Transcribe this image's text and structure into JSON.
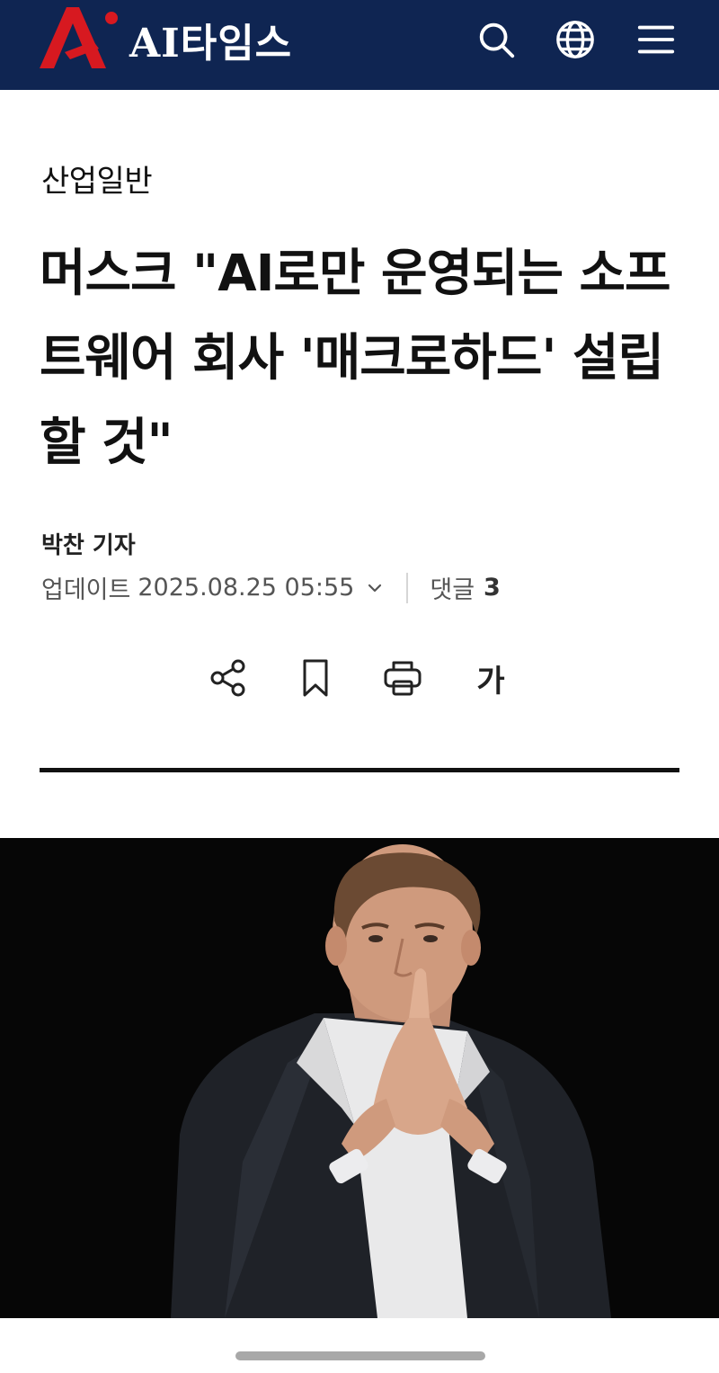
{
  "header": {
    "site_name": "AI타임스",
    "icons": [
      "search-icon",
      "globe-icon",
      "menu-icon"
    ],
    "background_color": "#0f2552",
    "logo_color": "#d71920"
  },
  "article": {
    "section": "산업일반",
    "title": "머스크 \"AI로만 운영되는 소프트웨어 회사 '매크로하드' 설립할 것\"",
    "author": "박찬 기자",
    "updated_label": "업데이트",
    "updated_datetime": "2025.08.25 05:55",
    "comments_label": "댓글",
    "comments_count": "3",
    "actions": {
      "share": "share-icon",
      "bookmark": "bookmark-icon",
      "print": "print-icon",
      "font_size_label": "가"
    }
  }
}
